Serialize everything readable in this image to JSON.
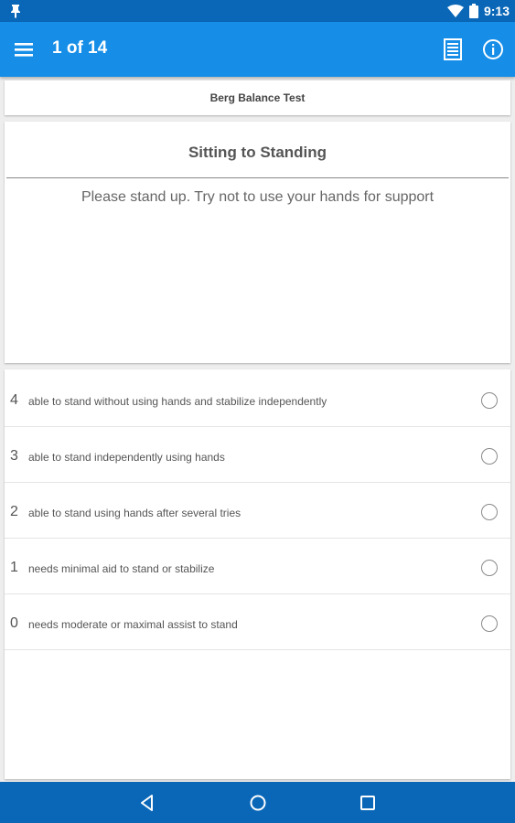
{
  "status_bar": {
    "time": "9:13",
    "icons": [
      "notification-pin-icon",
      "wifi-icon",
      "battery-icon"
    ]
  },
  "app_bar": {
    "title": "1 of 14",
    "icons": [
      "menu-icon",
      "document-icon",
      "info-icon"
    ],
    "color": "#168ee8"
  },
  "test": {
    "name": "Berg Balance Test"
  },
  "item": {
    "title": "Sitting to Standing",
    "instruction": "Please stand up. Try not to use your hands for support"
  },
  "options": [
    {
      "score": "4",
      "text": "able to stand without using hands and stabilize independently",
      "selected": false
    },
    {
      "score": "3",
      "text": "able to stand independently using hands",
      "selected": false
    },
    {
      "score": "2",
      "text": "able to stand using hands after several tries",
      "selected": false
    },
    {
      "score": "1",
      "text": "needs minimal aid to stand or stabilize",
      "selected": false
    },
    {
      "score": "0",
      "text": "needs moderate or maximal assist to stand",
      "selected": false
    }
  ],
  "nav_bar": {
    "icons": [
      "back-icon",
      "home-icon",
      "recents-icon"
    ],
    "color": "#0a67b7"
  }
}
